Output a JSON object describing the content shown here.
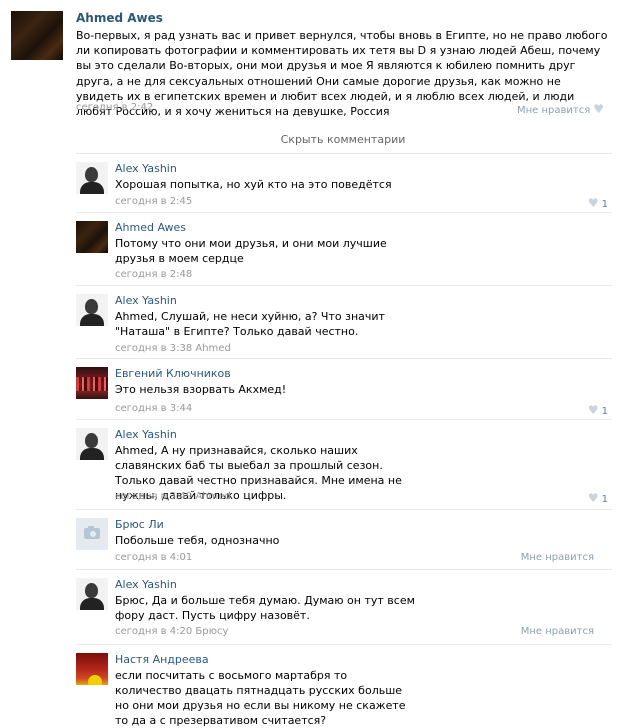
{
  "post": {
    "author": "Ahmed Awes",
    "text": "Во-первых, я рад узнать вас и привет вернулся, чтобы вновь в Египте, но не право любого ли копировать фотографии и комментировать их тетя вы D я узнаю людей Абеш, почему вы это сделали Во-вторых, они мои друзья и мое Я являются к юбилею помнить друг друга, а не для сексуальных отношений Они самые дорогие друзья, как можно не увидеть их в египетских времен и любит всех людей, и я люблю всех людей, и люди любят Россию, и я хочу жениться на девушке, Россия",
    "time": "сегодня в 2:42",
    "like_label": "Мне нравится"
  },
  "hide_comments_label": "Скрыть комментарии",
  "comments": [
    {
      "author": "Alex Yashin",
      "text": "Хорошая попытка, но хуй кто на это поведётся",
      "time": "сегодня в 2:45",
      "like_count": "1"
    },
    {
      "author": "Ahmed Awes",
      "text": "Потому что они мои друзья, и они мои лучшие друзья в моем сердце",
      "time": "сегодня в 2:48"
    },
    {
      "author": "Alex Yashin",
      "text": "Ahmed, Слушай, не неси хуйню, а? Что значит \"Наташа\" в Египте? Только давай честно.",
      "time": "сегодня в 3:38 Ahmed"
    },
    {
      "author": "Евгений Ключников",
      "text": "Это нельзя взорвать Акхмед!",
      "time": "сегодня в 3:44",
      "like_count": "1"
    },
    {
      "author": "Alex Yashin",
      "text": "Ahmed, А ну признавайся, сколько наших славянских баб ты выебал за прошлый сезон. Только давай честно признавайся. Мне имена не нужны, давай только цифры.",
      "time": "сегодня в 3:49 Ahmed",
      "like_count": "1"
    },
    {
      "author": "Брюс Ли",
      "text": "Побольше тебя, однозначно",
      "time": "сегодня в 4:01",
      "like_label": "Мне нравится"
    },
    {
      "author": "Alex Yashin",
      "text": "Брюс, Да и больше тебя думаю. Думаю он тут всем фору даст. Пусть цифру назовёт.",
      "time": "сегодня в 4:20 Брюсу",
      "like_label": "Мне нравится"
    },
    {
      "author": "Настя Андреева",
      "text": "если посчитать с восьмого мартабря то количество двацать пятнадцать русских больше но они мои друзья но если вы никому не скажете то да а с презервативом считается?"
    }
  ]
}
